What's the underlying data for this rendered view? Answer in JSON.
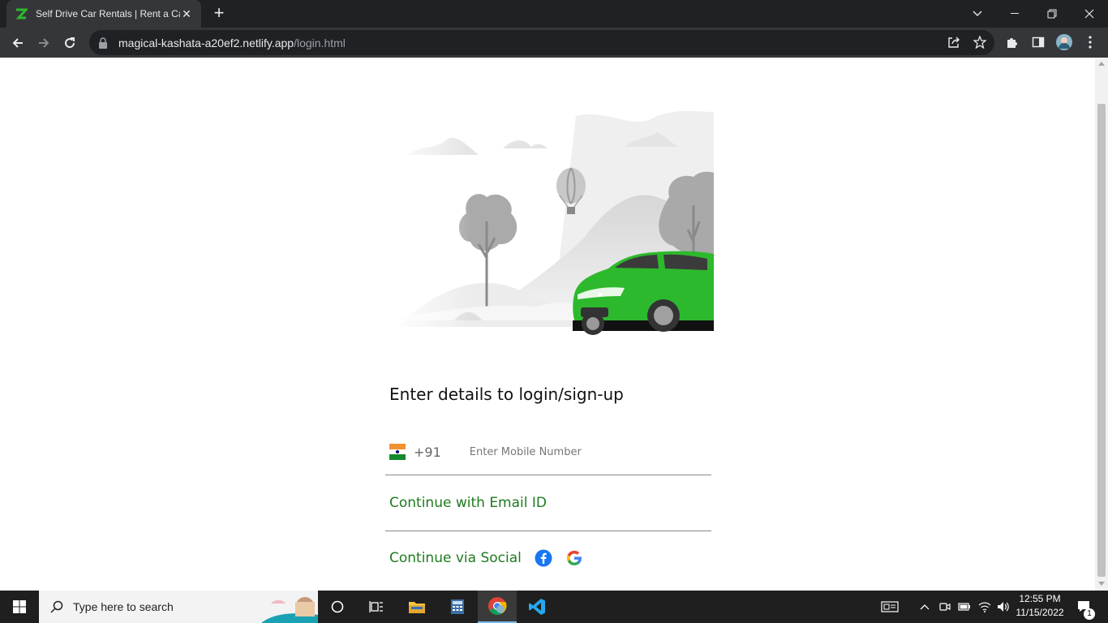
{
  "browser": {
    "tab_title": "Self Drive Car Rentals | Rent a Car",
    "tab_close": "✕",
    "new_tab": "+",
    "url_host": "magical-kashata-a20ef2.netlify.app",
    "url_path": "/login.html"
  },
  "login": {
    "heading": "Enter details to login/sign-up",
    "country_code": "+91",
    "mobile_placeholder": "Enter Mobile Number",
    "email_link": "Continue with Email ID",
    "social_label": "Continue via Social"
  },
  "taskbar": {
    "search_placeholder": "Type here to search",
    "time": "12:55 PM",
    "date": "11/15/2022",
    "notification_count": "1"
  },
  "colors": {
    "accent_green": "#1e7b20",
    "car_green": "#2db92d",
    "chrome_dark": "#202124",
    "chrome_toolbar": "#35363a"
  }
}
